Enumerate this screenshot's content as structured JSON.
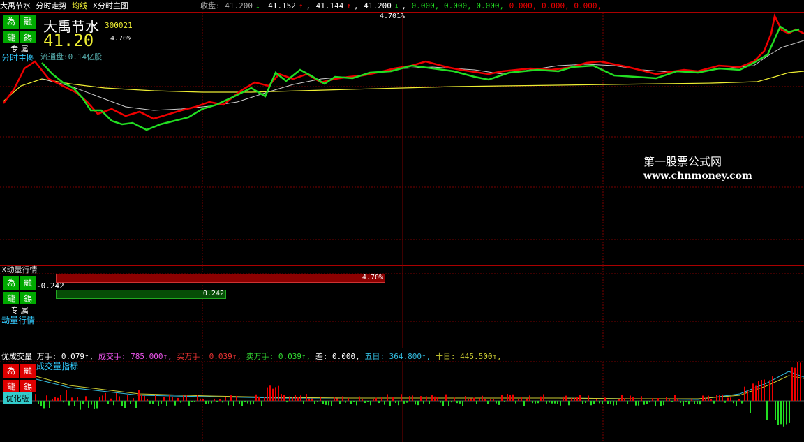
{
  "topbar": {
    "stock_name": "大禹节水",
    "tab_fenshi": "分时走势",
    "tab_junxian": "均线",
    "tab_main": "X分时主图",
    "close_label": "收盘: 41.200",
    "arrow_down": "↓",
    "arrow_up": "↑",
    "v1": "41.152",
    "v2": "41.144",
    "v3": "41.200",
    "zeros_green": "0.000, 0.000, 0.000,",
    "zeros_red": "0.000, 0.000, 0.000,",
    "pct_top": "4.701%"
  },
  "main": {
    "badge": [
      "為",
      "融",
      "龍",
      "錫"
    ],
    "zhuanshu": "专 属",
    "name": "大禹节水",
    "code": "300021",
    "price": "41.20",
    "pct": "4.70%",
    "chart_label": "分时主图",
    "float_shares": "流通盘:0.14亿股",
    "watermark_cn": "第一股票公式网",
    "watermark_url": "www.chnmoney.com"
  },
  "momentum": {
    "title": "X动量行情",
    "value_neg": "-0.242",
    "bar_red_label": "4.70%",
    "bar_green_label": "0.242",
    "red_fraction": 0.47,
    "green_fraction": 0.242,
    "badge": [
      "為",
      "融",
      "龍",
      "錫"
    ],
    "zhuanshu": "专 属",
    "side_label": "动量行情"
  },
  "volume": {
    "title": "优成交量",
    "wanshou": "万手: 0.079↑,",
    "chengjiao": "成交手: 785.000↑,",
    "mai": "买万手: 0.039↑,",
    "sell": "卖万手: 0.039↑,",
    "diff": "差: 0.000,",
    "wuri": "五日: 364.800↑,",
    "shiri": "十日: 445.500↑,",
    "badge": [
      "為",
      "融",
      "龍",
      "錫"
    ],
    "indicator": "成交量指标",
    "youhua": "优化版"
  },
  "colors": {
    "red": "#e00",
    "green": "#2d2",
    "yellow": "#ee3",
    "white": "#ddd",
    "grid": "#7a0000"
  }
}
